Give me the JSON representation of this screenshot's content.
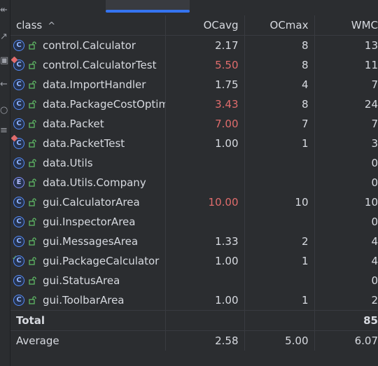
{
  "table": {
    "headers": [
      "class",
      "OCavg",
      "OCmax",
      "WMC"
    ],
    "sort_indicator": "^",
    "rows": [
      {
        "icon": "class",
        "badge": "",
        "name": "control.Calculator",
        "ocavg": "2.17",
        "ocavg_warn": false,
        "ocmax": "8",
        "wmc": "13"
      },
      {
        "icon": "class",
        "badge": "test",
        "name": "control.CalculatorTest",
        "ocavg": "5.50",
        "ocavg_warn": true,
        "ocmax": "8",
        "wmc": "11"
      },
      {
        "icon": "class",
        "badge": "",
        "name": "data.ImportHandler",
        "ocavg": "1.75",
        "ocavg_warn": false,
        "ocmax": "4",
        "wmc": "7"
      },
      {
        "icon": "class",
        "badge": "",
        "name": "data.PackageCostOptimizer",
        "ocavg": "3.43",
        "ocavg_warn": true,
        "ocmax": "8",
        "wmc": "24"
      },
      {
        "icon": "class",
        "badge": "",
        "name": "data.Packet",
        "ocavg": "7.00",
        "ocavg_warn": true,
        "ocmax": "7",
        "wmc": "7"
      },
      {
        "icon": "class",
        "badge": "test",
        "name": "data.PacketTest",
        "ocavg": "1.00",
        "ocavg_warn": false,
        "ocmax": "1",
        "wmc": "3"
      },
      {
        "icon": "class",
        "badge": "",
        "name": "data.Utils",
        "ocavg": "",
        "ocavg_warn": false,
        "ocmax": "",
        "wmc": "0"
      },
      {
        "icon": "enum",
        "badge": "",
        "name": "data.Utils.Company",
        "ocavg": "",
        "ocavg_warn": false,
        "ocmax": "",
        "wmc": "0"
      },
      {
        "icon": "class",
        "badge": "",
        "name": "gui.CalculatorArea",
        "ocavg": "10.00",
        "ocavg_warn": true,
        "ocmax": "10",
        "wmc": "10"
      },
      {
        "icon": "class",
        "badge": "",
        "name": "gui.InspectorArea",
        "ocavg": "",
        "ocavg_warn": false,
        "ocmax": "",
        "wmc": "0"
      },
      {
        "icon": "class",
        "badge": "",
        "name": "gui.MessagesArea",
        "ocavg": "1.33",
        "ocavg_warn": false,
        "ocmax": "2",
        "wmc": "4"
      },
      {
        "icon": "class",
        "badge": "check",
        "name": "gui.PackageCalculator",
        "ocavg": "1.00",
        "ocavg_warn": false,
        "ocmax": "1",
        "wmc": "4"
      },
      {
        "icon": "class",
        "badge": "",
        "name": "gui.StatusArea",
        "ocavg": "",
        "ocavg_warn": false,
        "ocmax": "",
        "wmc": "0"
      },
      {
        "icon": "class",
        "badge": "",
        "name": "gui.ToolbarArea",
        "ocavg": "1.00",
        "ocavg_warn": false,
        "ocmax": "1",
        "wmc": "2"
      }
    ],
    "total": {
      "label": "Total",
      "ocavg": "",
      "ocmax": "",
      "wmc": "85"
    },
    "average": {
      "label": "Average",
      "ocavg": "2.58",
      "ocmax": "5.00",
      "wmc": "6.07"
    }
  },
  "colors": {
    "background": "#2b2d30",
    "warn": "#e06c6c",
    "accent": "#3574f0",
    "class_icon": "#548af7",
    "lock_icon": "#5fb865"
  },
  "left_toolbar_icons": [
    "collapse-icon",
    "expand-icon",
    "camera-icon",
    "back-icon",
    "circle-icon",
    "settings-icon"
  ]
}
